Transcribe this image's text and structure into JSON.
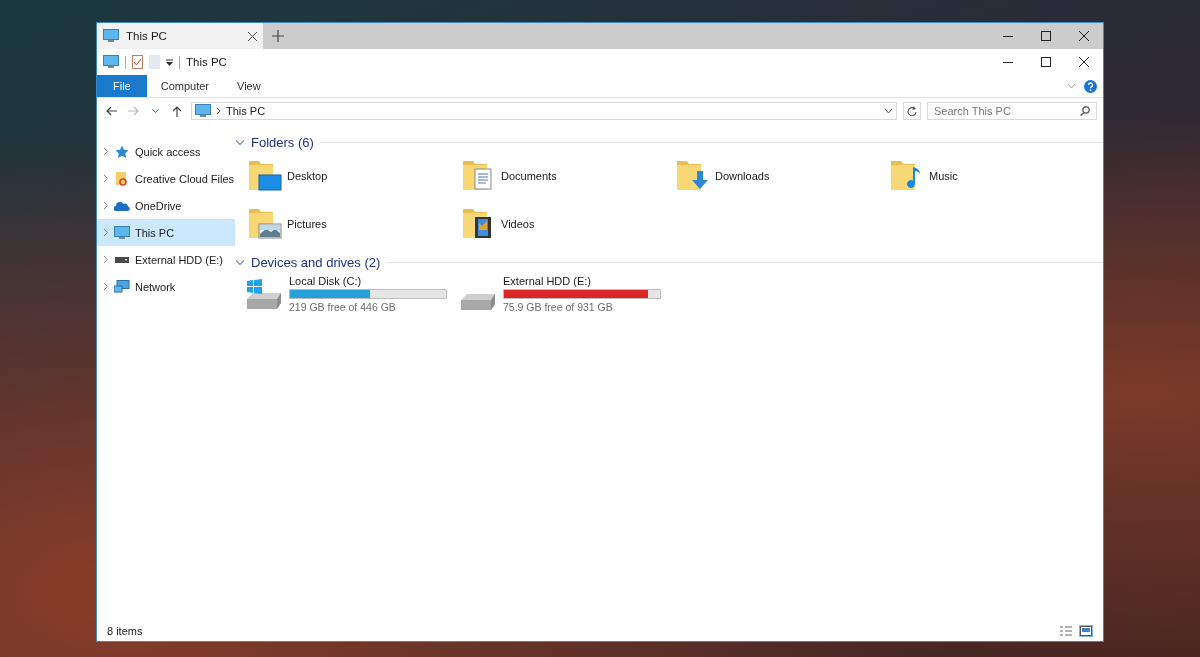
{
  "window_tabs": [
    {
      "title": "This PC",
      "selected": true
    }
  ],
  "title_bar": {
    "title": "This PC"
  },
  "ribbon_tabs": [
    {
      "label": "File",
      "kind": "menu"
    },
    {
      "label": "Computer",
      "kind": "tab"
    },
    {
      "label": "View",
      "kind": "tab"
    }
  ],
  "address_bar": {
    "path": "This PC"
  },
  "search": {
    "placeholder": "Search This PC"
  },
  "sidebar": {
    "items": [
      {
        "label": "Quick access",
        "selected": false
      },
      {
        "label": "Creative Cloud Files",
        "selected": false
      },
      {
        "label": "OneDrive",
        "selected": false
      },
      {
        "label": "This PC",
        "selected": true
      },
      {
        "label": "External HDD (E:)",
        "selected": false
      },
      {
        "label": "Network",
        "selected": false
      }
    ]
  },
  "folders": {
    "title": "Folders (6)",
    "expanded": true,
    "items": [
      {
        "name": "Desktop"
      },
      {
        "name": "Documents"
      },
      {
        "name": "Downloads"
      },
      {
        "name": "Music"
      },
      {
        "name": "Pictures"
      },
      {
        "name": "Videos"
      }
    ]
  },
  "drives": {
    "title": "Devices and drives (2)",
    "expanded": true,
    "items": [
      {
        "name": "Local Disk (C:)",
        "level": 0.51,
        "free": "219 GB free of 446 GB",
        "kind": "system"
      },
      {
        "name": "External HDD (E:)",
        "level": 0.92,
        "free": "75.9 GB free of 931 GB",
        "kind": "external"
      }
    ]
  },
  "status_bar": {
    "count": "8 items",
    "views": [
      {
        "selected": false
      },
      {
        "selected": true
      }
    ]
  }
}
